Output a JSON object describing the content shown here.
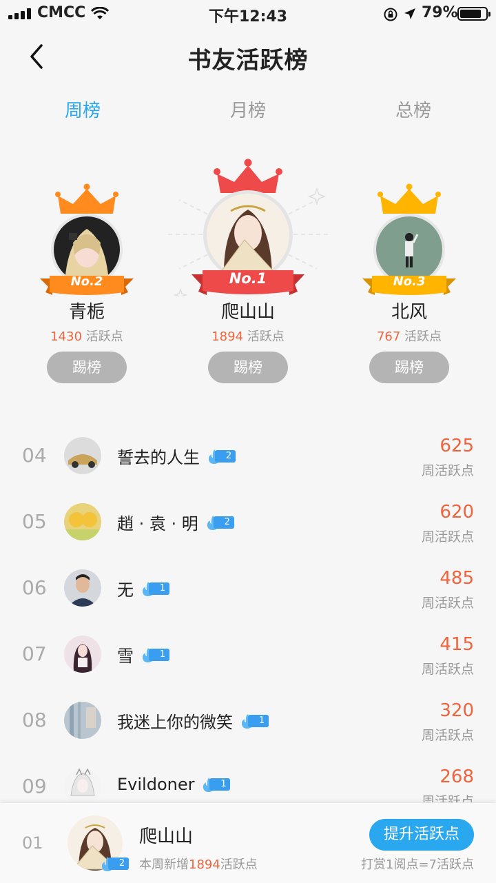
{
  "status_bar": {
    "carrier": "CMCC",
    "time": "下午12:43",
    "battery": "79%"
  },
  "nav": {
    "title": "书友活跃榜"
  },
  "tabs": [
    {
      "label": "周榜",
      "active": true
    },
    {
      "label": "月榜",
      "active": false
    },
    {
      "label": "总榜",
      "active": false
    }
  ],
  "podium": [
    {
      "position": "No.2",
      "name": "青栀",
      "score": "1430",
      "unit": "活跃点",
      "button": "踢榜",
      "ribbon_color": "#ff8a1e",
      "crown_color": "#ff8a1e"
    },
    {
      "position": "No.1",
      "name": "爬山山",
      "score": "1894",
      "unit": "活跃点",
      "button": "踢榜",
      "ribbon_color": "#ef4a4a",
      "crown_color": "#ef4a4a"
    },
    {
      "position": "No.3",
      "name": "北风",
      "score": "767",
      "unit": "活跃点",
      "button": "踢榜",
      "ribbon_color": "#ffb400",
      "crown_color": "#ffb400"
    }
  ],
  "list": [
    {
      "rank": "04",
      "name": "誓去的人生",
      "level": "2",
      "value": "625",
      "unit": "周活跃点"
    },
    {
      "rank": "05",
      "name": "趙 · 袁 · 明",
      "level": "2",
      "value": "620",
      "unit": "周活跃点"
    },
    {
      "rank": "06",
      "name": "无",
      "level": "1",
      "value": "485",
      "unit": "周活跃点"
    },
    {
      "rank": "07",
      "name": "雪",
      "level": "1",
      "value": "415",
      "unit": "周活跃点"
    },
    {
      "rank": "08",
      "name": "我迷上你的微笑",
      "level": "1",
      "value": "320",
      "unit": "周活跃点"
    },
    {
      "rank": "09",
      "name": "Evildoner",
      "level": "1",
      "value": "268",
      "unit": "周活跃点"
    }
  ],
  "me": {
    "rank": "01",
    "name": "爬山山",
    "level": "2",
    "sub_prefix": "本周新增",
    "sub_value": "1894",
    "sub_suffix": "活跃点",
    "button": "提升活跃点",
    "rule": "打赏1阅点=7活跃点"
  },
  "colors": {
    "accent": "#29a8f0",
    "score": "#f0643c",
    "muted": "#999999"
  }
}
